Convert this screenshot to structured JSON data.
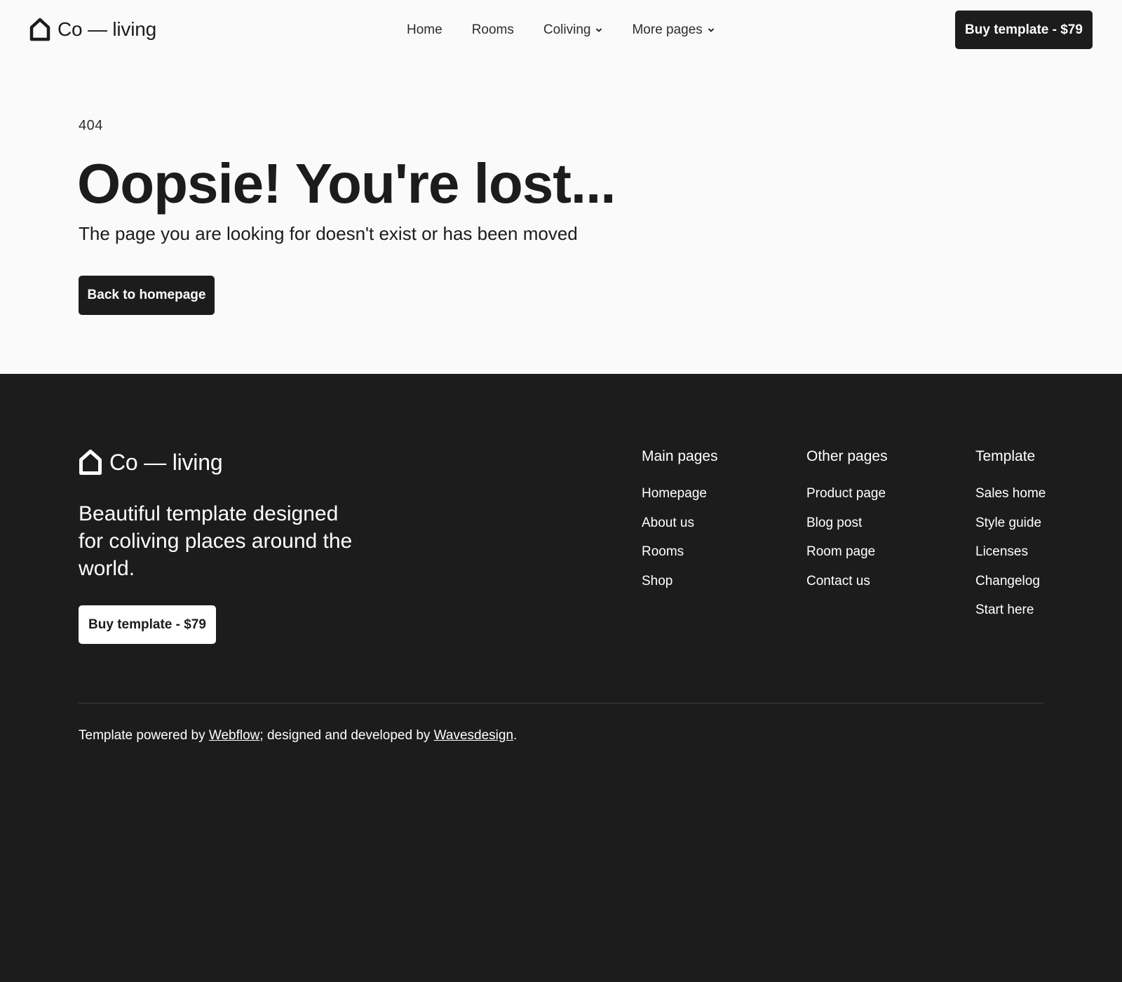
{
  "header": {
    "logo_text": "Co — living",
    "nav": [
      {
        "label": "Home",
        "dropdown": false
      },
      {
        "label": "Rooms",
        "dropdown": false
      },
      {
        "label": "Coliving",
        "dropdown": true
      },
      {
        "label": "More pages",
        "dropdown": true
      }
    ],
    "cta_label": "Buy template - $79"
  },
  "hero": {
    "code": "404",
    "title": "Oopsie! You're lost...",
    "subtitle": "The page you are looking for doesn't exist or has been moved",
    "button_label": "Back to homepage"
  },
  "footer": {
    "logo_text": "Co — living",
    "tagline": "Beautiful template designed for coliving places around the world.",
    "cta_label": "Buy template - $79",
    "columns": [
      {
        "title": "Main pages",
        "links": [
          "Homepage",
          "About us",
          "Rooms",
          "Shop"
        ]
      },
      {
        "title": "Other pages",
        "links": [
          "Product page",
          "Blog post",
          "Room page",
          "Contact us"
        ]
      },
      {
        "title": "Template",
        "links": [
          "Sales home",
          "Style guide",
          "Licenses",
          "Changelog",
          "Start here"
        ]
      }
    ],
    "credits": {
      "prefix": "Template powered by ",
      "link1": "Webflow",
      "middle": "; designed and developed by ",
      "link2": "Wavesdesign",
      "suffix": "."
    }
  },
  "colors": {
    "page_background": "#fafafa",
    "dark": "#1c1c1c",
    "light": "#ffffff"
  },
  "icons": [
    "house-icon",
    "chevron-down-icon"
  ]
}
